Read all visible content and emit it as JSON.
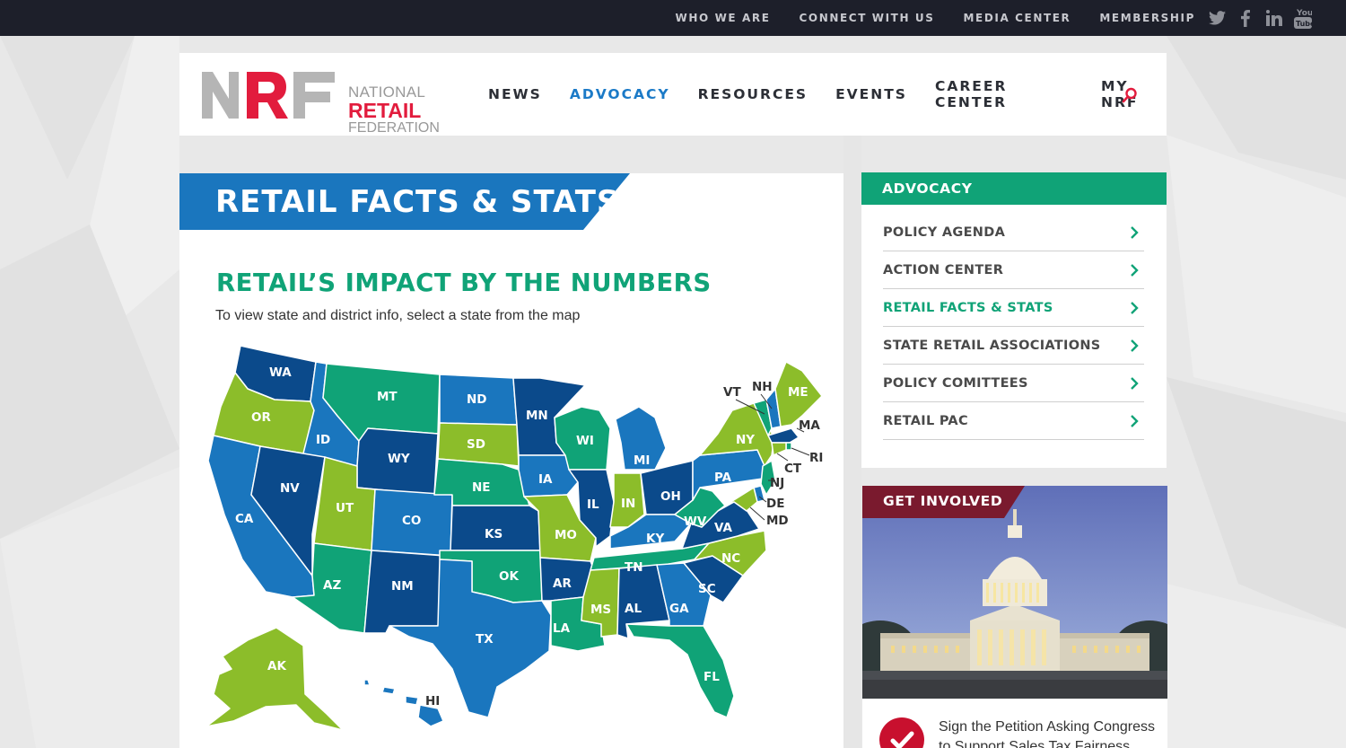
{
  "utility_nav": {
    "links": [
      "WHO WE ARE",
      "CONNECT WITH US",
      "MEDIA CENTER",
      "MEMBERSHIP"
    ],
    "social": [
      "twitter-icon",
      "facebook-icon",
      "linkedin-icon",
      "youtube-icon"
    ]
  },
  "header": {
    "logo_letters": "NRF",
    "logo_line1": "NATIONAL",
    "logo_line2": "RETAIL",
    "logo_line3": "FEDERATION",
    "nav": [
      "NEWS",
      "ADVOCACY",
      "RESOURCES",
      "EVENTS",
      "CAREER CENTER",
      "MY NRF"
    ],
    "active_nav": "ADVOCACY"
  },
  "main": {
    "page_title": "RETAIL FACTS & STATS",
    "section_heading": "RETAIL’S IMPACT BY THE NUMBERS",
    "instructions": "To view state and district info, select a state from the map",
    "map_states": [
      "WA",
      "OR",
      "CA",
      "ID",
      "NV",
      "MT",
      "WY",
      "UT",
      "AZ",
      "CO",
      "NM",
      "ND",
      "SD",
      "NE",
      "KS",
      "OK",
      "TX",
      "MN",
      "IA",
      "MO",
      "AR",
      "LA",
      "WI",
      "IL",
      "MI",
      "IN",
      "OH",
      "KY",
      "TN",
      "MS",
      "AL",
      "GA",
      "FL",
      "SC",
      "NC",
      "VA",
      "WV",
      "PA",
      "NY",
      "VT",
      "NH",
      "ME",
      "MA",
      "RI",
      "CT",
      "NJ",
      "DE",
      "MD",
      "AK",
      "HI"
    ]
  },
  "sidebar": {
    "title": "ADVOCACY",
    "items": [
      {
        "label": "POLICY AGENDA"
      },
      {
        "label": "ACTION CENTER"
      },
      {
        "label": "RETAIL FACTS & STATS"
      },
      {
        "label": "STATE RETAIL ASSOCIATIONS"
      },
      {
        "label": "POLICY COMITTEES"
      },
      {
        "label": "RETAIL PAC"
      }
    ],
    "active_item": "RETAIL FACTS & STATS"
  },
  "get_involved": {
    "title": "GET INVOLVED",
    "petition_text": "Sign the Petition Asking Congress to Support Sales Tax Fairness"
  },
  "colors": {
    "dark_blue": "#0b4a8b",
    "mid_blue": "#1a76be",
    "green": "#10a377",
    "lime": "#8cbd2a",
    "accent_blue": "#1b7ac7",
    "brand_red": "#e21c3d",
    "maroon": "#7a1a2e"
  }
}
